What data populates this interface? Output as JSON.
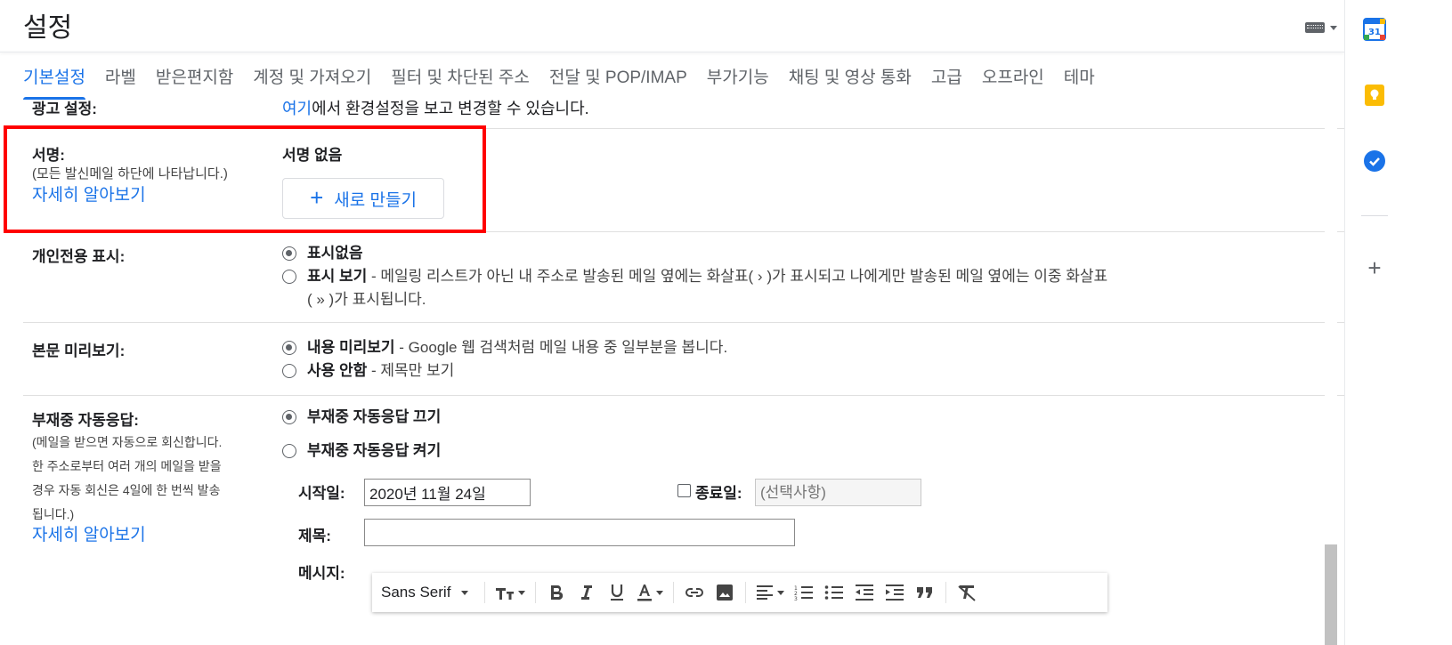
{
  "header": {
    "title": "설정",
    "keyboard_icon": "keyboard-icon"
  },
  "tabs": [
    {
      "label": "기본설정",
      "active": true
    },
    {
      "label": "라벨"
    },
    {
      "label": "받은편지함"
    },
    {
      "label": "계정 및 가져오기"
    },
    {
      "label": "필터 및 차단된 주소"
    },
    {
      "label": "전달 및 POP/IMAP"
    },
    {
      "label": "부가기능"
    },
    {
      "label": "채팅 및 영상 통화"
    },
    {
      "label": "고급"
    },
    {
      "label": "오프라인"
    },
    {
      "label": "테마"
    }
  ],
  "ads": {
    "label": "광고 설정:",
    "link": "여기",
    "text": "에서 환경설정을 보고 변경할 수 있습니다."
  },
  "signature": {
    "label": "서명:",
    "description": "(모든 발신메일 하단에 나타납니다.)",
    "learn_more": "자세히 알아보기",
    "value": "서명 없음",
    "new_button": "새로 만들기"
  },
  "personal_indicators": {
    "label": "개인전용 표시:",
    "options": [
      {
        "title": "표시없음",
        "desc": "",
        "selected": true
      },
      {
        "title": "표시 보기",
        "desc": " - 메일링 리스트가 아닌 내 주소로 발송된 메일 옆에는 화살표( › )가 표시되고 나에게만 발송된 메일 옆에는 이중 화살표",
        "desc2": "( » )가 표시됩니다.",
        "selected": false
      }
    ]
  },
  "snippets": {
    "label": "본문 미리보기:",
    "options": [
      {
        "title": "내용 미리보기",
        "desc": " - Google 웹 검색처럼 메일 내용 중 일부분을 봅니다.",
        "selected": true
      },
      {
        "title": "사용 안함",
        "desc": " - 제목만 보기",
        "selected": false
      }
    ]
  },
  "vacation": {
    "label": "부재중 자동응답:",
    "description": [
      "(메일을 받으면 자동으로 회신합니다.",
      "한 주소로부터 여러 개의 메일을 받을",
      "경우 자동 회신은 4일에 한 번씩 발송",
      "됩니다.)"
    ],
    "learn_more": "자세히 알아보기",
    "off_option": "부재중 자동응답 끄기",
    "on_option": "부재중 자동응답 켜기",
    "start_label": "시작일:",
    "start_value": "2020년 11월 24일",
    "end_label": "종료일:",
    "end_placeholder": "(선택사항)",
    "subject_label": "제목:",
    "subject_value": "",
    "message_label": "메시지:"
  },
  "toolbar": {
    "font": "Sans Serif",
    "buttons": [
      "text-size-icon",
      "bold-icon",
      "italic-icon",
      "underline-icon",
      "text-color-icon",
      "link-icon",
      "image-icon",
      "align-icon",
      "numbered-list-icon",
      "bulleted-list-icon",
      "indent-less-icon",
      "indent-more-icon",
      "quote-icon",
      "remove-formatting-icon"
    ]
  },
  "rail": {
    "calendar_day": "31"
  },
  "colors": {
    "accent": "#1a73e8",
    "highlight_box": "#ff0000"
  }
}
